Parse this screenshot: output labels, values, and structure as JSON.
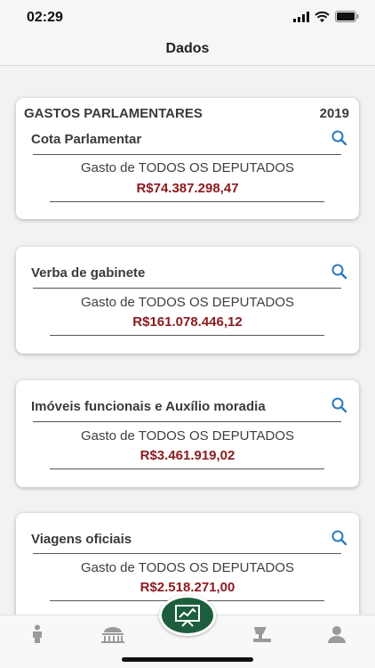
{
  "status": {
    "time": "02:29"
  },
  "nav": {
    "title": "Dados"
  },
  "header": {
    "section": "GASTOS PARLAMENTARES",
    "year": "2019"
  },
  "cards": [
    {
      "title": "Cota Parlamentar",
      "description": "Gasto de TODOS OS DEPUTADOS",
      "amount": "R$74.387.298,47"
    },
    {
      "title": "Verba de gabinete",
      "description": "Gasto de TODOS OS DEPUTADOS",
      "amount": "R$161.078.446,12"
    },
    {
      "title": "Imóveis funcionais e Auxílio moradia",
      "description": "Gasto de TODOS OS DEPUTADOS",
      "amount": "R$3.461.919,02"
    },
    {
      "title": "Viagens oficiais",
      "description": "Gasto de TODOS OS DEPUTADOS",
      "amount": "R$2.518.271,00"
    }
  ],
  "tabs": [
    "person-icon",
    "congress-building-icon",
    "presentation-chart-icon",
    "voting-icon",
    "user-profile-icon"
  ],
  "colors": {
    "accent": "#1c5e3c",
    "amount": "#8b1a1f",
    "search": "#2b7bbf"
  }
}
